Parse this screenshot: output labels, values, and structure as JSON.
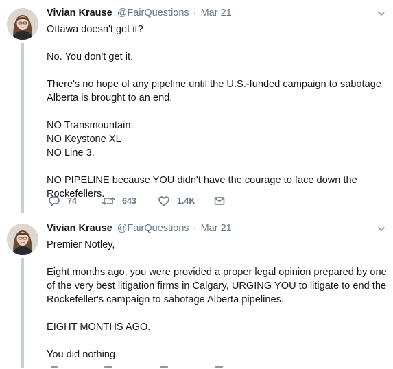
{
  "tweets": [
    {
      "author_name": "Vivian Krause",
      "author_handle": "@FairQuestions",
      "separator": "·",
      "date": "Mar 21",
      "text": "Ottawa doesn't get it?\n\nNo. You don't get it.\n\nThere's no hope of any pipeline until the U.S.-funded campaign to sabotage Alberta is brought to an end.\n\nNO Transmountain.\nNO Keystone XL\nNO Line 3.\n\nNO PIPELINE because YOU didn't have the courage to face down the Rockefellers.",
      "reply_count": "74",
      "retweet_count": "643",
      "like_count": "1.4K",
      "icons": {
        "reply": "reply-icon",
        "retweet": "retweet-icon",
        "like": "heart-icon",
        "dm": "envelope-icon",
        "more": "chevron-down-icon"
      }
    },
    {
      "author_name": "Vivian Krause",
      "author_handle": "@FairQuestions",
      "separator": "·",
      "date": "Mar 21",
      "text": "Premier Notley,\n\nEight months ago, you were provided a proper legal opinion prepared by one of the very best litigation firms in Calgary, URGING YOU to litigate to end the Rockefeller's campaign to sabotage Alberta pipelines.\n\nEIGHT MONTHS AGO.\n\nYou did nothing."
    }
  ],
  "colors": {
    "text": "#14171a",
    "secondary": "#657786",
    "thread_line": "#c4cfd6"
  }
}
